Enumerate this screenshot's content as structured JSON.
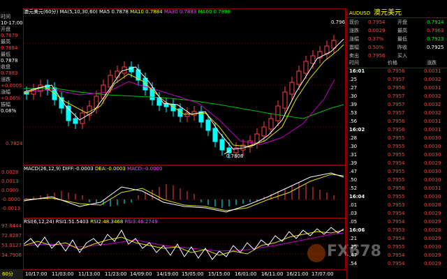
{
  "chart_header": {
    "title": "澳元美元(60分)",
    "ma_label": "MA(5,10,30,60)",
    "ma5": "MA5 0.7878",
    "ma10": "MA10 0.7884",
    "ma30": "MA30 0.7883",
    "ma60": "MA60 0.7898"
  },
  "info_panel": {
    "time_label": "时间",
    "time_value": "10-17:00",
    "open_label": "开盘",
    "open_value": "0.7879",
    "high_label": "最高",
    "high_value": "0.7884",
    "low_label": "最低",
    "low_value": "0.7878",
    "close_label": "收盘",
    "close_value": "0.7883",
    "change_label": "涨跌",
    "change_value": "+0.0005",
    "pct_label": "涨幅",
    "pct_value": "+0.06%",
    "amp_label": "振幅",
    "amp_value": "0.08%"
  },
  "price_axis": {
    "low_mark": "0.7808",
    "high_mark": "0.7963",
    "mid1": "0.7824"
  },
  "macd": {
    "label": "MACD(26,12,9)",
    "diff": "DIFF:-0.0003",
    "dea": "DEA:-0.0003",
    "macd": "MACD:-0.0000",
    "axis": [
      "0.0028",
      "0.0013",
      "0.0000",
      "-0.0000",
      "-0.0013"
    ]
  },
  "rsi": {
    "label": "RSI(6,12,24)",
    "rsi1": "RSI1:51.5403",
    "rsi2": "RSI2:48.3468",
    "rsi3": "RSI3:46.2749",
    "axis": [
      "97.8444",
      "72.8287",
      "53.0127",
      "34.7906"
    ]
  },
  "period_tab": "60分",
  "x_axis": [
    "10/17:00",
    "11/03:00",
    "11/13:00",
    "11/23:00",
    "14/09:00",
    "14/19:00",
    "15/05:00",
    "15/15:00",
    "16/01:00",
    "16/11:00",
    "16/21:00",
    "17/07:00"
  ],
  "quote": {
    "symbol": "AUDUSD",
    "name": "澳元美元",
    "now_label": "现价",
    "now_value": "0.7954",
    "open_label": "开盘",
    "open_value": "0.7924",
    "change_label": "涨跌",
    "change_value": "0.0029",
    "high_label": "最高",
    "high_value": "0.7963",
    "pct_label": "涨幅",
    "pct_value": "0.37%",
    "low_label": "最低",
    "low_value": "0.7923",
    "amp_label": "震幅",
    "amp_value": "0.50%",
    "prev_label": "昨收",
    "prev_value": "0.7925",
    "sell_label": "卖出",
    "sell_value": "0.7956",
    "buy_label": "买入",
    "buy_value": "",
    "col_time": "时间",
    "col_price": "价格",
    "col_change": "涨跌"
  },
  "ticks": [
    {
      "t": "16:01",
      "p": "0.7956",
      "c": "0.0031"
    },
    {
      "t": ".25",
      "p": "0.7957",
      "c": "0.0032"
    },
    {
      "t": ".27",
      "p": "0.7956",
      "c": "0.0031"
    },
    {
      "t": ".30",
      "p": "0.7957",
      "c": "0.0032"
    },
    {
      "t": ".39",
      "p": "0.7957",
      "c": "0.0032"
    },
    {
      "t": ".53",
      "p": "0.7957",
      "c": "0.0032"
    },
    {
      "t": ".56",
      "p": "0.7956",
      "c": "0.0031"
    },
    {
      "t": "16:02",
      "p": "0.7956",
      "c": "0.0031"
    },
    {
      "t": ".28",
      "p": "0.7955",
      "c": "0.0030"
    },
    {
      "t": ".30",
      "p": "0.7955",
      "c": "0.0030"
    },
    {
      "t": ".31",
      "p": "0.7955",
      "c": "0.0030"
    },
    {
      "t": ".39",
      "p": "0.7954",
      "c": "0.0029"
    },
    {
      "t": ".47",
      "p": "0.7955",
      "c": "0.0030"
    },
    {
      "t": ".50",
      "p": "0.7955",
      "c": "0.0030"
    },
    {
      "t": ".52",
      "p": "0.7956",
      "c": "0.0031"
    },
    {
      "t": "16:04",
      "p": "0.7955",
      "c": "0.0030"
    },
    {
      "t": ".01",
      "p": "0.7953",
      "c": "0.0028"
    },
    {
      "t": ".03",
      "p": "0.7954",
      "c": "0.0029"
    },
    {
      "t": ".05",
      "p": "0.7954",
      "c": "0.0029"
    },
    {
      "t": "16:06",
      "p": "0.7953",
      "c": "0.0028"
    },
    {
      "t": ".21",
      "p": "0.7954",
      "c": "0.0029"
    },
    {
      "t": ".25",
      "p": "0.7955",
      "c": "0.0030"
    },
    {
      "t": ".47",
      "p": "0.7954",
      "c": "0.0029"
    },
    {
      "t": ".54",
      "p": "0.7954",
      "c": "0.0029"
    }
  ],
  "watermark": "FX678",
  "colors": {
    "up": "#ff4040",
    "down": "#00ffff",
    "ma5": "#ffffff",
    "ma10": "#ffff00",
    "ma30": "#ff40ff",
    "ma60": "#00ff00",
    "frame": "#8b0000"
  }
}
